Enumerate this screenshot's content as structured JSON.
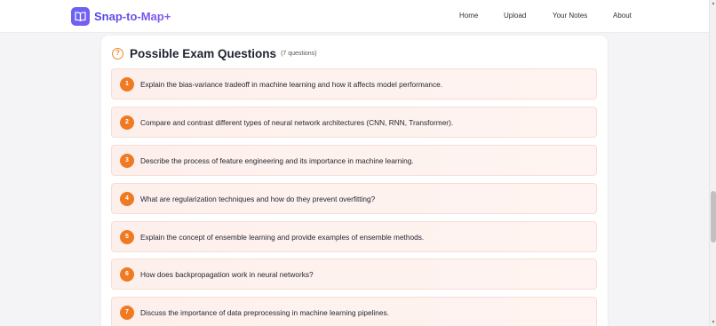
{
  "header": {
    "brand": "Snap-to-Map+",
    "logo_icon": "book-open-icon",
    "nav": [
      "Home",
      "Upload",
      "Your Notes",
      "About"
    ]
  },
  "section": {
    "icon": "question-circle-icon",
    "title": "Possible Exam Questions",
    "count": "(7 questions)"
  },
  "questions": [
    {
      "num": "1",
      "text": "Explain the bias-variance tradeoff in machine learning and how it affects model performance."
    },
    {
      "num": "2",
      "text": "Compare and contrast different types of neural network architectures (CNN, RNN, Transformer)."
    },
    {
      "num": "3",
      "text": "Describe the process of feature engineering and its importance in machine learning."
    },
    {
      "num": "4",
      "text": "What are regularization techniques and how do they prevent overfitting?"
    },
    {
      "num": "5",
      "text": "Explain the concept of ensemble learning and provide examples of ensemble methods."
    },
    {
      "num": "6",
      "text": "How does backpropagation work in neural networks?"
    },
    {
      "num": "7",
      "text": "Discuss the importance of data preprocessing in machine learning pipelines."
    }
  ],
  "colors": {
    "accent": "#f07a22",
    "brand_start": "#4f46e5",
    "brand_end": "#8b5cf6",
    "item_bg": "#fdf0ec"
  }
}
